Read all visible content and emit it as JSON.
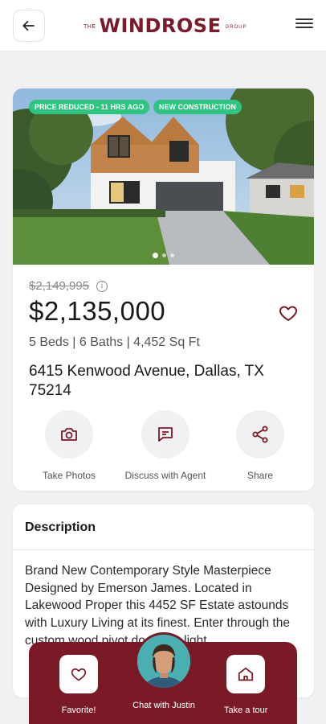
{
  "header": {
    "logo_the": "THE",
    "logo_main": "WINDROSE",
    "logo_group": "GROUP"
  },
  "listing": {
    "badges": [
      "PRICE REDUCED - 11 HRS AGO",
      "NEW CONSTRUCTION"
    ],
    "old_price": "$2,149,995",
    "info_symbol": "i",
    "price": "$2,135,000",
    "specs": "5 Beds | 6 Baths | 4,452 Sq Ft",
    "address": "6415 Kenwood Avenue, Dallas, TX 75214",
    "carousel_total": 3,
    "carousel_active": 1
  },
  "actions": {
    "take_photos": "Take Photos",
    "discuss_agent": "Discuss with Agent",
    "share": "Share"
  },
  "description": {
    "title": "Description",
    "body": "Brand New Contemporary Style Masterpiece Designed by Emerson James. Located in Lakewood Proper this 4452 SF Estate astounds with Luxury Living at its finest. Enter through the custom wood pivot door to a light"
  },
  "bottom_bar": {
    "favorite": "Favorite!",
    "chat": "Chat with Justin",
    "tour": "Take a tour"
  },
  "colors": {
    "brand": "#7b1a27",
    "badge": "#2ec482"
  },
  "icons": [
    "back-arrow-icon",
    "hamburger-menu-icon",
    "heart-icon",
    "info-icon",
    "camera-icon",
    "chat-icon",
    "share-icon",
    "home-icon"
  ]
}
